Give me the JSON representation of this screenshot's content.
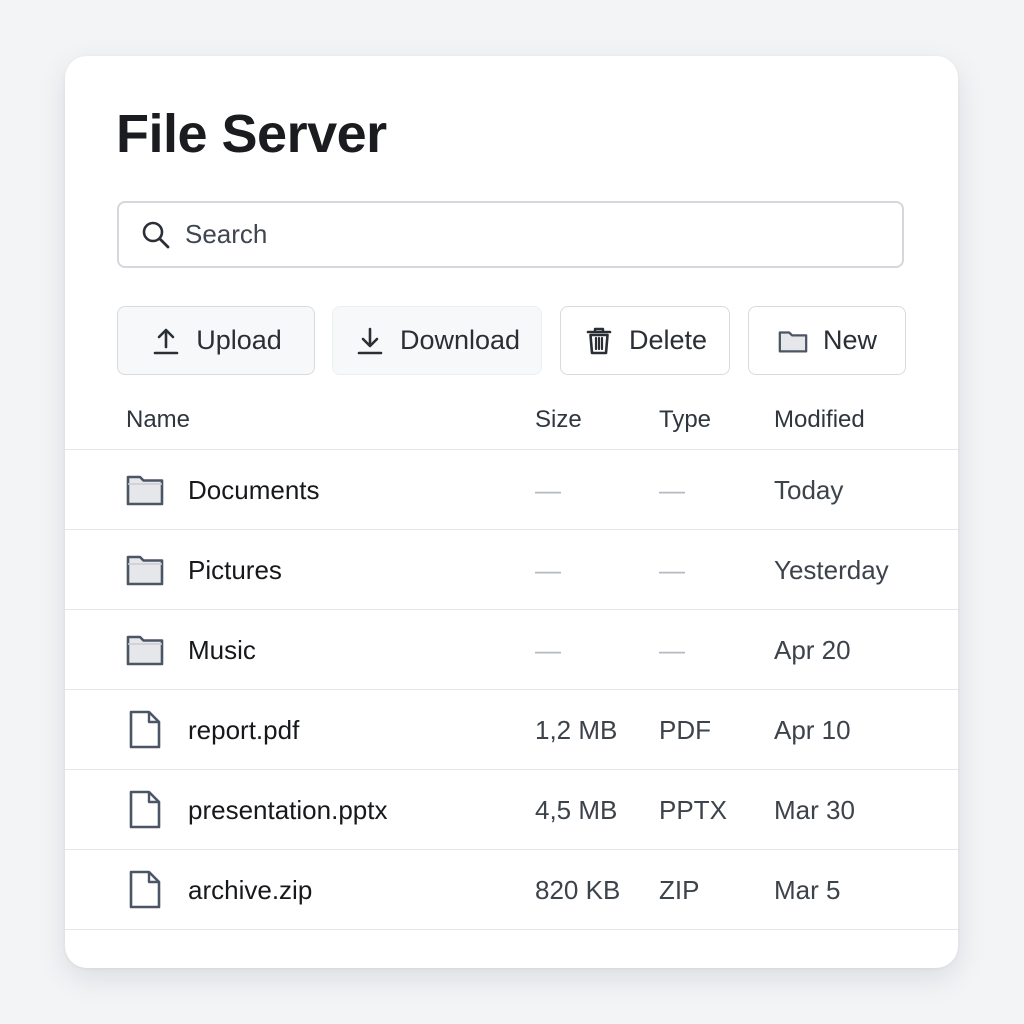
{
  "app": {
    "title": "File Server"
  },
  "search": {
    "placeholder": "Search",
    "value": ""
  },
  "toolbar": {
    "upload_label": "Upload",
    "download_label": "Download",
    "delete_label": "Delete",
    "new_label": "New"
  },
  "table": {
    "columns": {
      "name": "Name",
      "size": "Size",
      "type": "Type",
      "modified": "Modified"
    },
    "rows": [
      {
        "icon": "folder-icon",
        "name": "Documents",
        "size": "—",
        "type": "—",
        "modified": "Today"
      },
      {
        "icon": "folder-icon",
        "name": "Pictures",
        "size": "—",
        "type": "—",
        "modified": "Yesterday"
      },
      {
        "icon": "folder-icon",
        "name": "Music",
        "size": "—",
        "type": "—",
        "modified": "Apr 20"
      },
      {
        "icon": "file-icon",
        "name": "report.pdf",
        "size": "1,2 MB",
        "type": "PDF",
        "modified": "Apr 10"
      },
      {
        "icon": "file-icon",
        "name": "presentation.pptx",
        "size": "4,5 MB",
        "type": "PPTX",
        "modified": "Mar 30"
      },
      {
        "icon": "file-icon",
        "name": "archive.zip",
        "size": "820 KB",
        "type": "ZIP",
        "modified": "Mar 5"
      }
    ]
  },
  "colors": {
    "background": "#f3f4f6",
    "card": "#ffffff",
    "text": "#1a1c1f",
    "muted": "#3d434b",
    "border": "#d4d7dc",
    "icon": "#4b5563",
    "folder_fill": "#e5e7eb"
  }
}
